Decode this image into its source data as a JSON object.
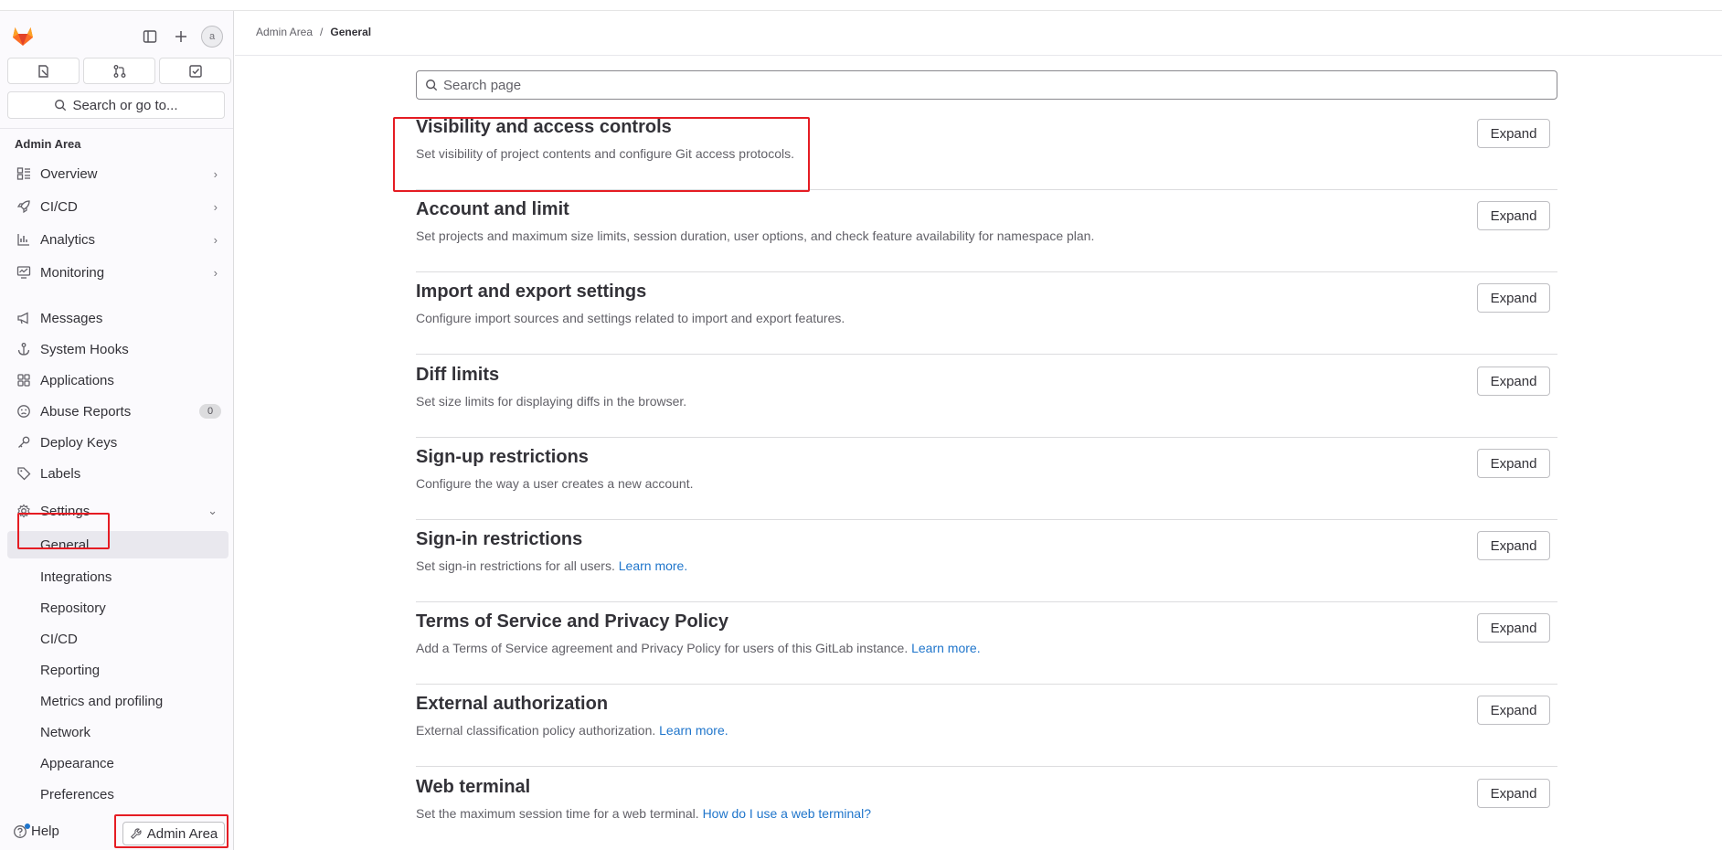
{
  "colors": {
    "accent": "#1f75cb",
    "highlight": "#e51c23",
    "logo_orange": "#fc6d26",
    "logo_red": "#e24329",
    "logo_yellow": "#fca326"
  },
  "sidebar": {
    "logo_icon": "gitlab-tanuki-logo",
    "top_icons": [
      "sidebar-toggle-icon",
      "plus-icon"
    ],
    "avatar_alt": "a",
    "quick_actions": [
      "issues-icon",
      "merge-requests-icon",
      "todo-icon"
    ],
    "search_label": "Search or go to...",
    "section_title": "Admin Area",
    "items": [
      {
        "label": "Overview",
        "icon": "overview-icon",
        "chevron": true
      },
      {
        "label": "CI/CD",
        "icon": "rocket-icon",
        "chevron": true
      },
      {
        "label": "Analytics",
        "icon": "chart-icon",
        "chevron": true
      },
      {
        "label": "Monitoring",
        "icon": "monitor-icon",
        "chevron": true
      },
      {
        "label": "Messages",
        "icon": "megaphone-icon"
      },
      {
        "label": "System Hooks",
        "icon": "anchor-icon"
      },
      {
        "label": "Applications",
        "icon": "grid-icon"
      },
      {
        "label": "Abuse Reports",
        "icon": "smiley-icon",
        "badge": "0"
      },
      {
        "label": "Deploy Keys",
        "icon": "key-icon"
      },
      {
        "label": "Labels",
        "icon": "label-icon"
      },
      {
        "label": "Settings",
        "icon": "gear-icon",
        "chevron_down": true
      }
    ],
    "settings_sub": [
      {
        "label": "General",
        "active": true
      },
      {
        "label": "Integrations"
      },
      {
        "label": "Repository"
      },
      {
        "label": "CI/CD"
      },
      {
        "label": "Reporting"
      },
      {
        "label": "Metrics and profiling"
      },
      {
        "label": "Network"
      },
      {
        "label": "Appearance"
      },
      {
        "label": "Preferences"
      }
    ],
    "help_label": "Help",
    "admin_button_label": "Admin Area"
  },
  "breadcrumb": [
    "Admin Area",
    "General"
  ],
  "search": {
    "placeholder": "Search page"
  },
  "expand_label": "Expand",
  "settings": [
    {
      "title": "Visibility and access controls",
      "desc": "Set visibility of project contents and configure Git access protocols."
    },
    {
      "title": "Account and limit",
      "desc": "Set projects and maximum size limits, session duration, user options, and check feature availability for namespace plan."
    },
    {
      "title": "Import and export settings",
      "desc": "Configure import sources and settings related to import and export features."
    },
    {
      "title": "Diff limits",
      "desc": "Set size limits for displaying diffs in the browser."
    },
    {
      "title": "Sign-up restrictions",
      "desc": "Configure the way a user creates a new account."
    },
    {
      "title": "Sign-in restrictions",
      "desc": "Set sign-in restrictions for all users.",
      "link": "Learn more."
    },
    {
      "title": "Terms of Service and Privacy Policy",
      "desc": "Add a Terms of Service agreement and Privacy Policy for users of this GitLab instance.",
      "link": "Learn more."
    },
    {
      "title": "External authorization",
      "desc": "External classification policy authorization.",
      "link": "Learn more."
    },
    {
      "title": "Web terminal",
      "desc": "Set the maximum session time for a web terminal.",
      "link": "How do I use a web terminal?"
    }
  ]
}
